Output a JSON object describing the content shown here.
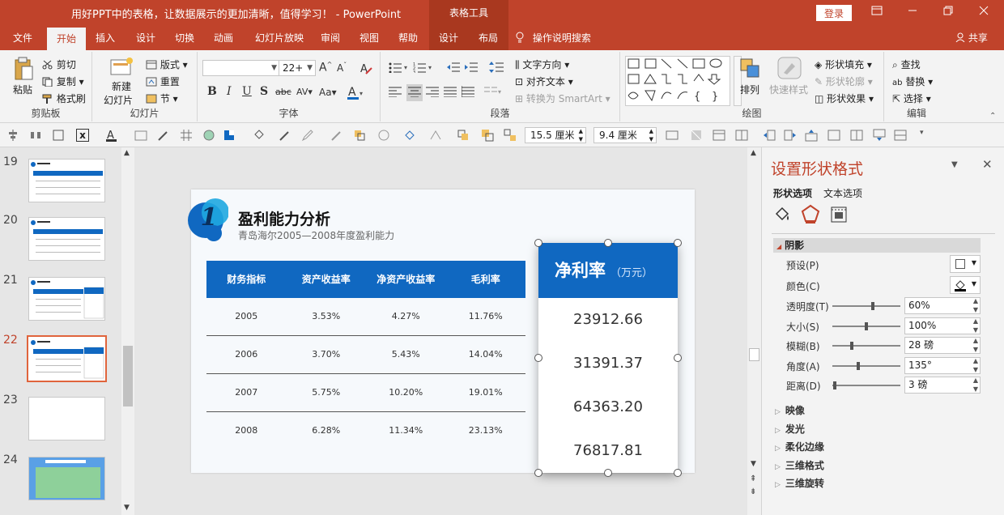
{
  "titlebar": {
    "doc_title": "用好PPT中的表格，让数据展示的更加清晰，值得学习！  -  PowerPoint",
    "context_group": "表格工具",
    "login": "登录"
  },
  "tabs": [
    "文件",
    "开始",
    "插入",
    "设计",
    "切换",
    "动画",
    "幻灯片放映",
    "审阅",
    "视图",
    "帮助",
    "设计",
    "布局"
  ],
  "tell_me": "操作说明搜索",
  "share": "共享",
  "ribbon": {
    "clipboard": {
      "paste": "粘贴",
      "cut": "剪切",
      "copy": "复制",
      "format_painter": "格式刷",
      "label": "剪贴板"
    },
    "slides": {
      "new_slide_1": "新建",
      "new_slide_2": "幻灯片",
      "layout": "版式",
      "reset": "重置",
      "section": "节",
      "label": "幻灯片"
    },
    "font": {
      "font_name": "",
      "font_size": "22+",
      "label": "字体"
    },
    "paragraph": {
      "text_direction": "文字方向",
      "align_text": "对齐文本",
      "smartart": "转换为 SmartArt",
      "label": "段落"
    },
    "drawing": {
      "arrange": "排列",
      "quick_styles": "快速样式",
      "shape_fill": "形状填充",
      "shape_outline": "形状轮廓",
      "shape_effects": "形状效果",
      "label": "绘图"
    },
    "editing": {
      "find": "查找",
      "replace": "替换",
      "select": "选择",
      "label": "编辑"
    }
  },
  "qtoolbar": {
    "height": "15.5 厘米",
    "width": "9.4 厘米"
  },
  "thumbnails": [
    {
      "num": "19",
      "active": false
    },
    {
      "num": "20",
      "active": false
    },
    {
      "num": "21",
      "active": false
    },
    {
      "num": "22",
      "active": true
    },
    {
      "num": "23",
      "active": false
    },
    {
      "num": "24",
      "active": false
    }
  ],
  "slide": {
    "badge": "1",
    "title": "盈利能力分析",
    "subtitle": "青岛海尔2005—2008年度盈利能力",
    "table": {
      "headers": [
        "财务指标",
        "资产收益率",
        "净资产收益率",
        "毛利率"
      ],
      "rows": [
        [
          "2005",
          "3.53%",
          "4.27%",
          "11.76%"
        ],
        [
          "2006",
          "3.70%",
          "5.43%",
          "14.04%"
        ],
        [
          "2007",
          "5.75%",
          "10.20%",
          "19.01%"
        ],
        [
          "2008",
          "6.28%",
          "11.34%",
          "23.13%"
        ]
      ]
    },
    "net_box": {
      "title": "净利率",
      "unit": "（万元）",
      "values": [
        "23912.66",
        "31391.37",
        "64363.20",
        "76817.81"
      ]
    }
  },
  "pane": {
    "title": "设置形状格式",
    "opt_shape": "形状选项",
    "opt_text": "文本选项",
    "section": "阴影",
    "preset": "预设(P)",
    "color": "颜色(C)",
    "props": [
      {
        "label": "透明度(T)",
        "value": "60%",
        "level": 0.6
      },
      {
        "label": "大小(S)",
        "value": "100%",
        "level": 0.5
      },
      {
        "label": "模糊(B)",
        "value": "28 磅",
        "level": 0.28
      },
      {
        "label": "角度(A)",
        "value": "135°",
        "level": 0.375
      },
      {
        "label": "距离(D)",
        "value": "3 磅",
        "level": 0.03
      }
    ],
    "collapsed": [
      "映像",
      "发光",
      "柔化边缘",
      "三维格式",
      "三维旋转"
    ]
  },
  "colors": {
    "accent": "#c0432b",
    "table_blue": "#1068c1"
  }
}
